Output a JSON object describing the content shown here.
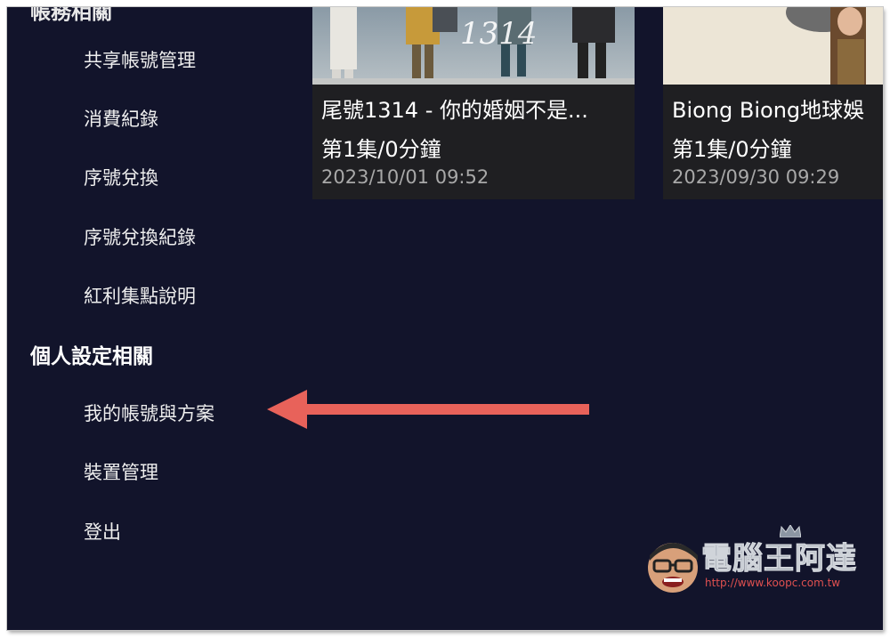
{
  "sidebar": {
    "top_section_partial": "帳務相關",
    "items_top": [
      {
        "label": "共享帳號管理"
      },
      {
        "label": "消費紀錄"
      },
      {
        "label": "序號兌換"
      },
      {
        "label": "序號兌換紀錄"
      },
      {
        "label": "紅利集點說明"
      }
    ],
    "section_personal": "個人設定相關",
    "items_personal": [
      {
        "label": "我的帳號與方案"
      },
      {
        "label": "裝置管理"
      },
      {
        "label": "登出"
      }
    ]
  },
  "history": [
    {
      "title": "尾號1314 - 你的婚姻不是...",
      "episode": "第1集/0分鐘",
      "date": "2023/10/01 09:52",
      "thumb_text": "1314"
    },
    {
      "title": "Biong Biong地球娛",
      "episode": "第1集/0分鐘",
      "date": "2023/09/30 09:29"
    }
  ],
  "annotation": {
    "arrow_color": "#e8625a",
    "target": "我的帳號與方案"
  },
  "watermark": {
    "title": "電腦王阿達",
    "url": "http://www.koopc.com.tw"
  },
  "colors": {
    "background": "#12142b",
    "card": "#1f1f22",
    "date_text": "#a8a8a8"
  }
}
